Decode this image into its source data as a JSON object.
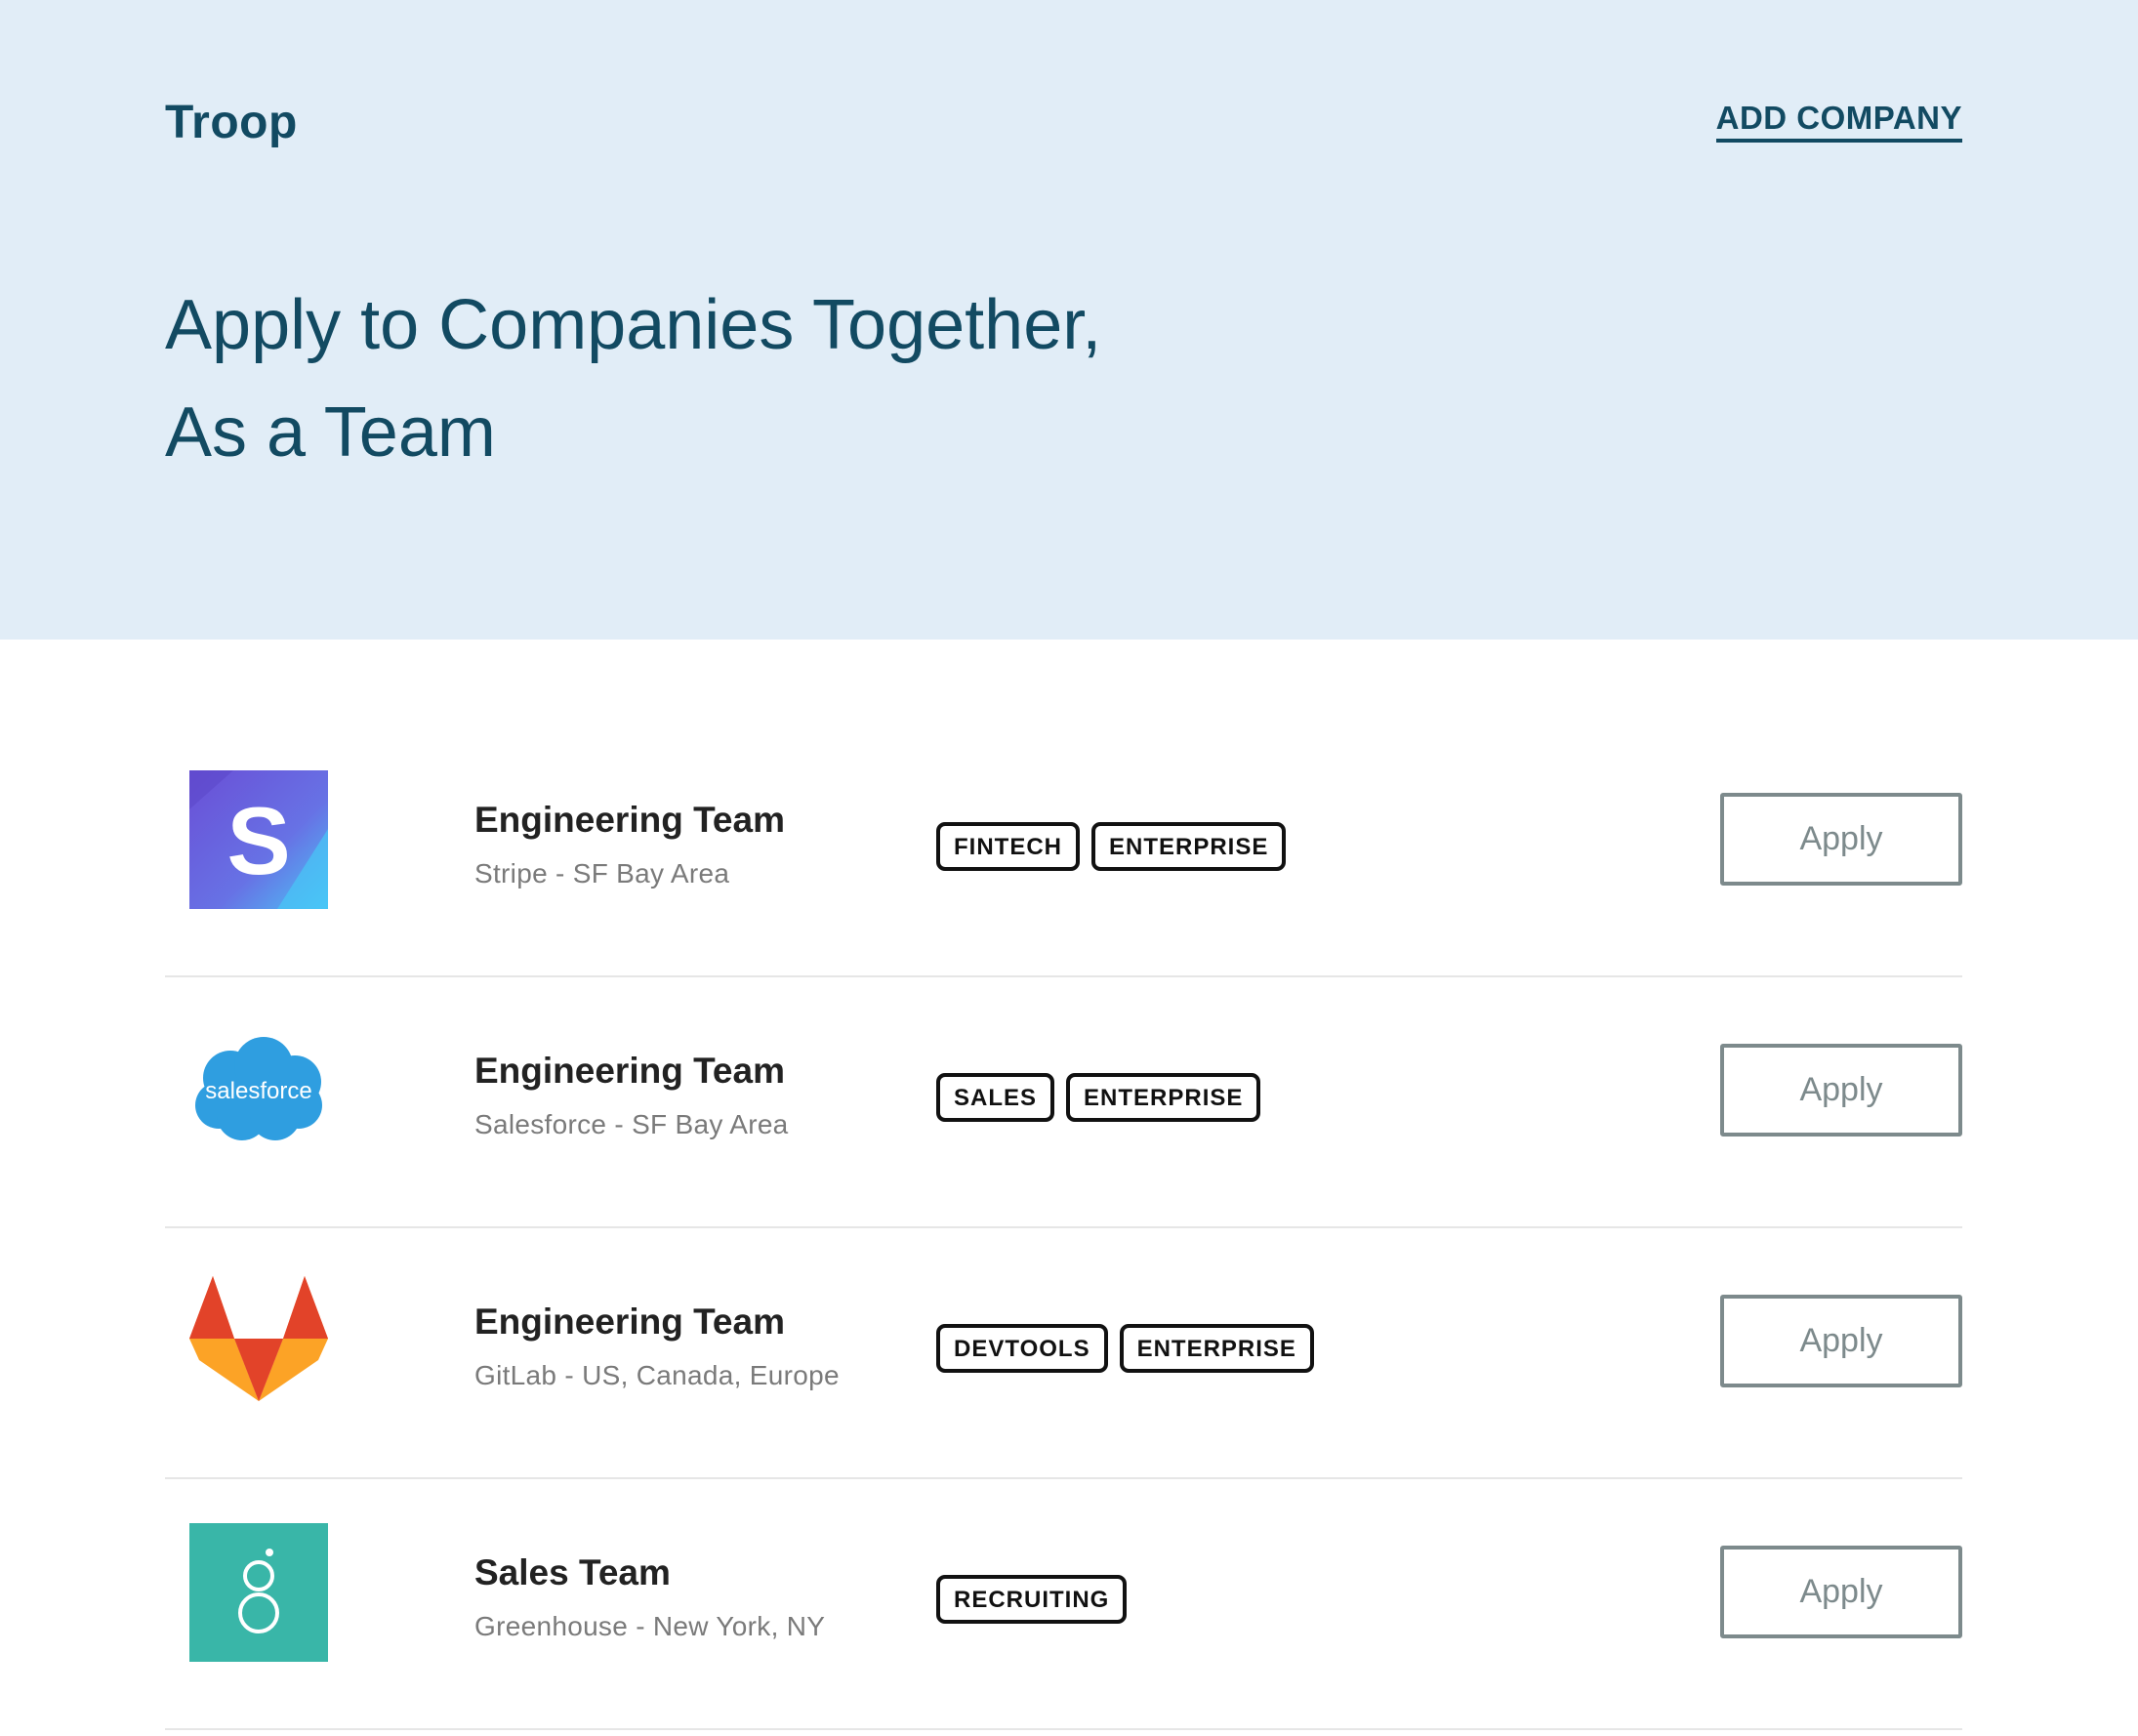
{
  "header": {
    "brand": "Troop",
    "add_company_label": "ADD COMPANY",
    "headline_line1": "Apply to Companies Together,",
    "headline_line2": "As a Team"
  },
  "colors": {
    "hero_background": "#e1edf7",
    "brand_text": "#124a62",
    "button_border": "#7d8a8c"
  },
  "listings": [
    {
      "logo_icon": "stripe-logo-icon",
      "logo_text": "S",
      "team": "Engineering Team",
      "company_location": "Stripe - SF Bay Area",
      "tags": [
        "FINTECH",
        "ENTERPRISE"
      ],
      "apply_label": "Apply"
    },
    {
      "logo_icon": "salesforce-logo-icon",
      "logo_text": "salesforce",
      "team": "Engineering Team",
      "company_location": "Salesforce - SF Bay Area",
      "tags": [
        "SALES",
        "ENTERPRISE"
      ],
      "apply_label": "Apply"
    },
    {
      "logo_icon": "gitlab-logo-icon",
      "team": "Engineering Team",
      "company_location": "GitLab - US, Canada, Europe",
      "tags": [
        "DEVTOOLS",
        "ENTERPRISE"
      ],
      "apply_label": "Apply"
    },
    {
      "logo_icon": "greenhouse-logo-icon",
      "team": "Sales Team",
      "company_location": "Greenhouse - New York, NY",
      "tags": [
        "RECRUITING"
      ],
      "apply_label": "Apply"
    }
  ]
}
